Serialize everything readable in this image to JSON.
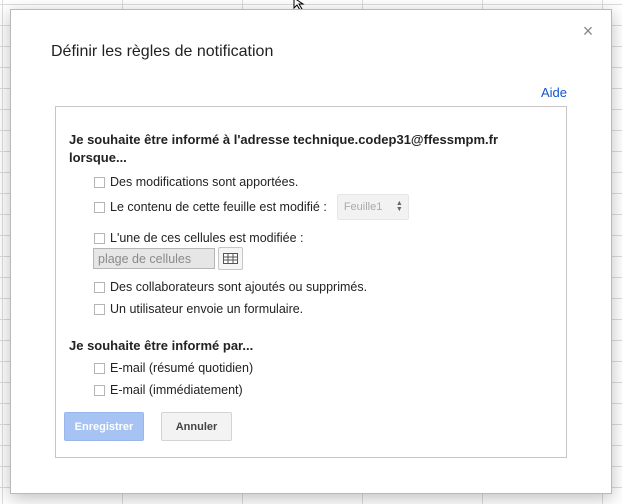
{
  "dialog": {
    "title": "Définir les règles de notification",
    "close_icon": "×",
    "help_label": "Aide"
  },
  "notify_when": {
    "heading": "Je souhaite être informé à l'adresse technique.codep31@ffessmpm.fr lorsque...",
    "options": [
      {
        "label": "Des modifications sont apportées.",
        "checked": false
      },
      {
        "label": "Le contenu de cette feuille est modifié :",
        "checked": false
      },
      {
        "label": "L'une de ces cellules est modifiée :",
        "checked": false
      },
      {
        "label": "Des collaborateurs sont ajoutés ou supprimés.",
        "checked": false
      },
      {
        "label": "Un utilisateur envoie un formulaire.",
        "checked": false
      }
    ],
    "sheet_select_value": "Feuille1",
    "range_placeholder": "plage de cellules"
  },
  "notify_by": {
    "heading": "Je souhaite être informé par...",
    "options": [
      {
        "label": "E-mail (résumé quotidien)",
        "checked": false
      },
      {
        "label": "E-mail (immédiatement)",
        "checked": false
      }
    ]
  },
  "buttons": {
    "save_label": "Enregistrer",
    "cancel_label": "Annuler"
  },
  "colors": {
    "save_button_disabled": "#a6c3f3",
    "link": "#1155cc"
  }
}
